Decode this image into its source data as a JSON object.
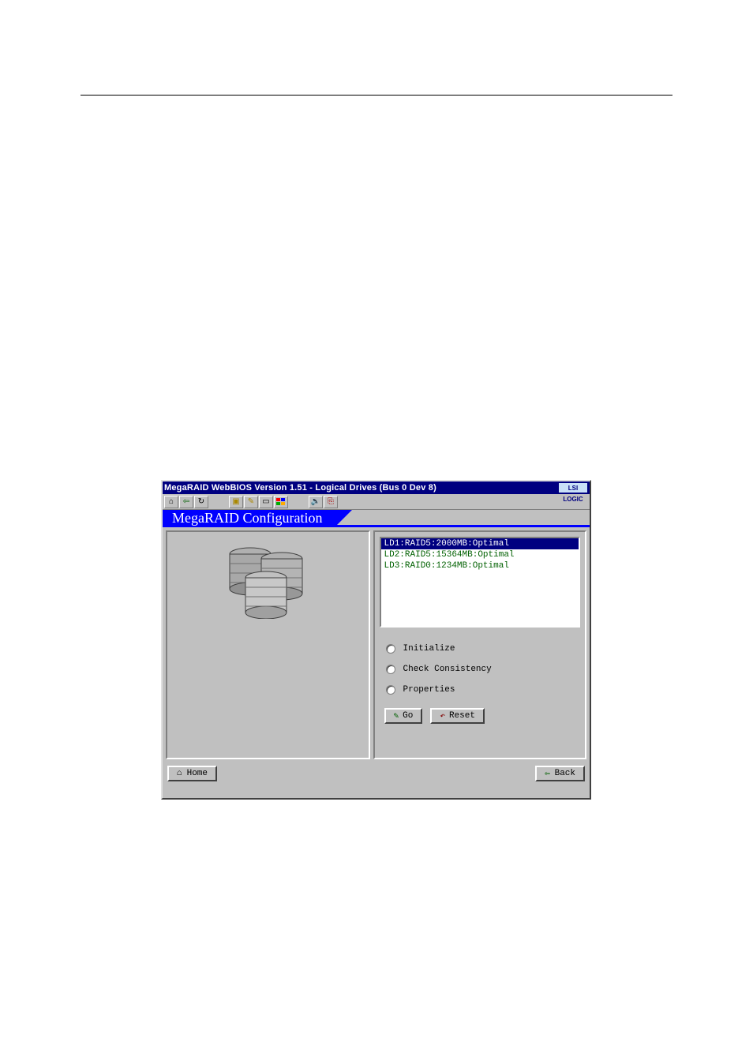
{
  "window": {
    "title": "MegaRAID WebBIOS Version 1.51 - Logical Drives (Bus 0 Dev 8)",
    "logo_text": "LSI LOGIC"
  },
  "panel": {
    "title": "MegaRAID Configuration"
  },
  "toolbar_icons": {
    "home": "home-icon",
    "back": "back-icon",
    "refresh": "refresh-icon",
    "folder": "folder-icon",
    "key": "key-icon",
    "drive": "drive-icon",
    "blocks": "blocks-icon",
    "sound": "sound-icon",
    "exit": "exit-icon"
  },
  "logical_drives": [
    {
      "text": "LD1:RAID5:2000MB:Optimal",
      "selected": true
    },
    {
      "text": "LD2:RAID5:15364MB:Optimal",
      "selected": false
    },
    {
      "text": "LD3:RAID0:1234MB:Optimal",
      "selected": false
    }
  ],
  "radios": {
    "initialize": "Initialize",
    "check_consistency": "Check Consistency",
    "properties": "Properties"
  },
  "buttons": {
    "go": "Go",
    "reset": "Reset",
    "home": "Home",
    "back": "Back"
  }
}
